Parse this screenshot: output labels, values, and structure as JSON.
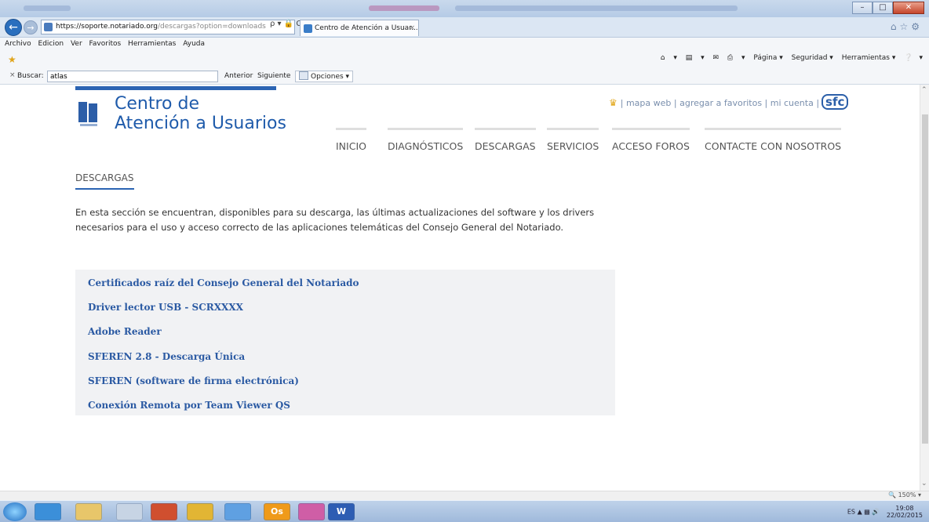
{
  "browser": {
    "url_host": "https://soporte.notariado.org",
    "url_path": "/descargas?option=downloads",
    "address_tools": "ρ ▾ 🔒 C",
    "tab_title": "Centro de Atención a Usuar...",
    "tab_close": "×",
    "menu": [
      "Archivo",
      "Edicion",
      "Ver",
      "Favoritos",
      "Herramientas",
      "Ayuda"
    ],
    "command_bar": [
      "▾",
      "▾",
      "▾",
      "Página ▾",
      "Seguridad ▾",
      "Herramientas ▾",
      "▾"
    ],
    "find": {
      "close": "×",
      "label": "Buscar:",
      "value": "atlas",
      "prev": "Anterior",
      "next": "Siguiente",
      "options": "Opciones ▾"
    },
    "zoom": "150%"
  },
  "site": {
    "title_line1": "Centro de",
    "title_line2": "Atención a Usuarios",
    "top_links": "| mapa web | agregar a favoritos | mi cuenta |",
    "sfc": "sfc",
    "nav": [
      "INICIO",
      "DIAGNÓSTICOS",
      "DESCARGAS",
      "SERVICIOS",
      "ACCESO FOROS",
      "CONTACTE CON NOSOTROS"
    ],
    "accent_color": "#2c64b3"
  },
  "main": {
    "section_title": "DESCARGAS",
    "intro": "En esta sección se encuentran, disponibles para su descarga, las últimas actualizaciones del software y los drivers necesarios para el uso y acceso correcto de las aplicaciones telemáticas del Consejo General del Notariado.",
    "downloads": [
      "Certificados raíz del Consejo General del Notariado",
      "Driver lector USB - SCRXXXX",
      "Adobe Reader",
      "SFEREN 2.8 - Descarga Única",
      "SFEREN (software de firma electrónica)",
      "Conexión Remota por Team Viewer QS"
    ]
  },
  "taskbar": {
    "apps": [
      "IE",
      "Carpeta",
      "Archivo",
      "Office",
      "Chrome",
      "Info",
      "Outlook",
      "iTunes",
      "Word"
    ],
    "app_labels": [
      "",
      "",
      "",
      "",
      "",
      "",
      "Os",
      "",
      "W"
    ],
    "tray_lang": "ES",
    "time": "19:08",
    "date": "22/02/2015"
  }
}
